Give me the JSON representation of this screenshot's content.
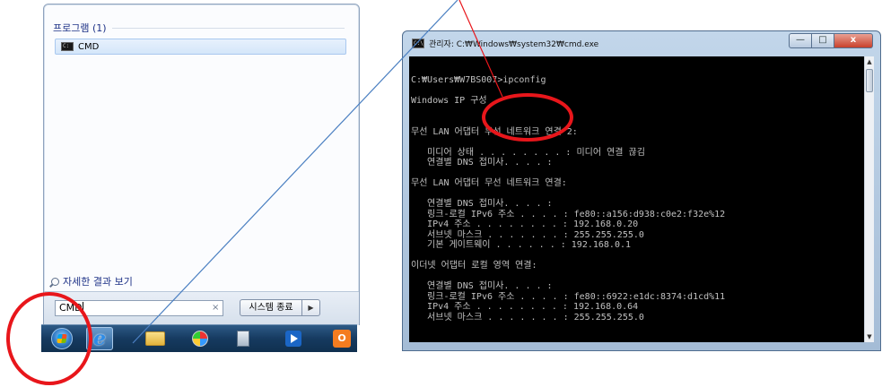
{
  "start_menu": {
    "programs_header": "프로그램 (1)",
    "result_item": "CMD",
    "see_more": "자세한 결과 보기",
    "search_value": "CMD",
    "clear_glyph": "×",
    "shutdown_label": "시스템 종료",
    "shutdown_arrow": "▶"
  },
  "taskbar": {
    "ie_glyph": "e",
    "office_glyph": "O"
  },
  "cmd": {
    "title": "관리자: C:₩Windows₩system32₩cmd.exe",
    "icon_glyph": "C:\\",
    "minimize_glyph": "—",
    "maximize_glyph": "□",
    "close_glyph": "x",
    "lines": [
      "C:₩Users₩W7BS007>ipconfig",
      "",
      "Windows IP 구성",
      "",
      "",
      "무선 LAN 어댑터 무선 네트워크 연결 2:",
      "",
      "   미디어 상태 . . . . . . . . : 미디어 연결 끊김",
      "   연결별 DNS 접미사. . . . :",
      "",
      "무선 LAN 어댑터 무선 네트워크 연결:",
      "",
      "   연결별 DNS 접미사. . . . :",
      "   링크-로컬 IPv6 주소 . . . . : fe80::a156:d938:c0e2:f32e%12",
      "   IPv4 주소 . . . . . . . . : 192.168.0.20",
      "   서브넷 마스크 . . . . . . . : 255.255.255.0",
      "   기본 게이트웨이 . . . . . . : 192.168.0.1",
      "",
      "이더넷 어댑터 로컬 영역 연결:",
      "",
      "   연결별 DNS 접미사. . . . :",
      "   링크-로컬 IPv6 주소 . . . . : fe80::6922:e1dc:8374:d1cd%11",
      "   IPv4 주소 . . . . . . . . : 192.168.0.64",
      "   서브넷 마스크 . . . . . . . : 255.255.255.0"
    ],
    "scroll_up": "▲",
    "scroll_down": "▼"
  },
  "colors": {
    "annotation_red": "#e8161b",
    "connector_blue": "#4a7fc1"
  }
}
